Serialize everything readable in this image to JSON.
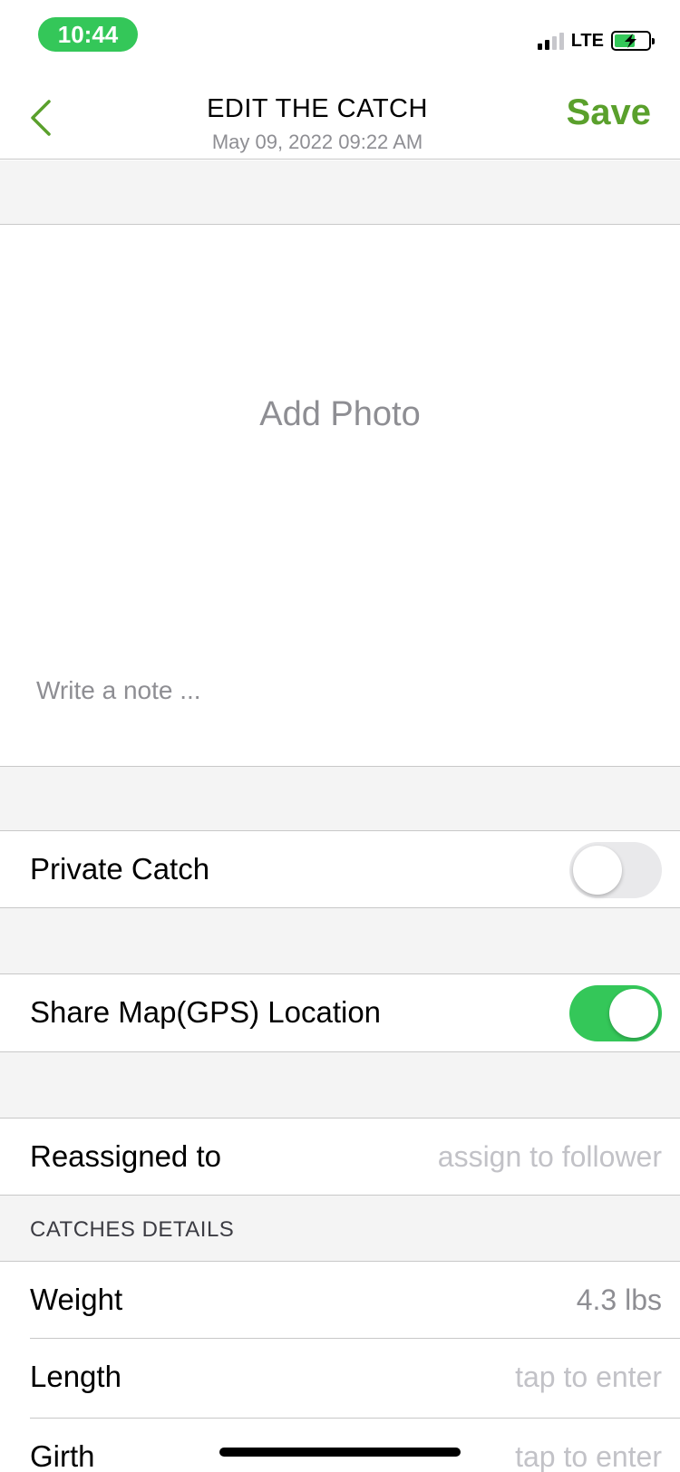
{
  "status_bar": {
    "time": "10:44",
    "network": "LTE",
    "accent_color": "#34c759"
  },
  "nav": {
    "title": "EDIT THE CATCH",
    "subtitle": "May 09, 2022 09:22 AM",
    "save_label": "Save",
    "back_icon": "chevron-left-icon",
    "accent_color": "#5aa02c"
  },
  "photo": {
    "add_photo_label": "Add Photo",
    "note_placeholder": "Write a note ..."
  },
  "settings": {
    "private_catch": {
      "label": "Private Catch",
      "enabled": false
    },
    "share_location": {
      "label": "Share Map(GPS) Location",
      "enabled": true
    },
    "reassigned": {
      "label": "Reassigned to",
      "placeholder": "assign to follower"
    }
  },
  "details": {
    "section_title": "CATCHES DETAILS",
    "weight": {
      "label": "Weight",
      "value": "4.3 lbs"
    },
    "length": {
      "label": "Length",
      "placeholder": "tap to enter"
    },
    "girth": {
      "label": "Girth",
      "placeholder": "tap to enter"
    }
  }
}
